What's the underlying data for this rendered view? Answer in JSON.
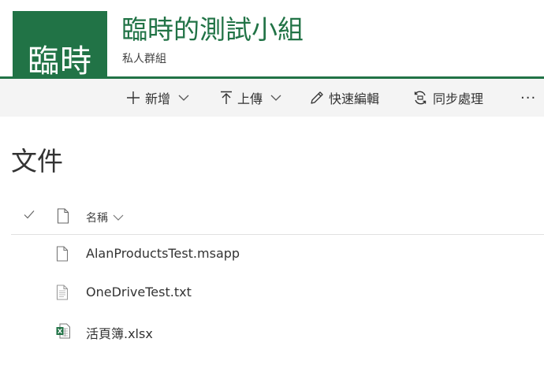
{
  "site": {
    "logo_text": "臨時",
    "title": "臨時的測試小組",
    "subtitle": "私人群組",
    "brand_color": "#217346"
  },
  "commands": {
    "new_label": "新增",
    "upload_label": "上傳",
    "quick_edit_label": "快速編輯",
    "sync_label": "同步處理",
    "more_label": "···"
  },
  "page": {
    "heading": "文件"
  },
  "list": {
    "column_name": "名稱",
    "items": [
      {
        "name": "AlanProductsTest.msapp",
        "icon": "generic-file-icon"
      },
      {
        "name": "OneDriveTest.txt",
        "icon": "text-file-icon"
      },
      {
        "name": "活頁簿.xlsx",
        "icon": "excel-file-icon"
      }
    ]
  }
}
